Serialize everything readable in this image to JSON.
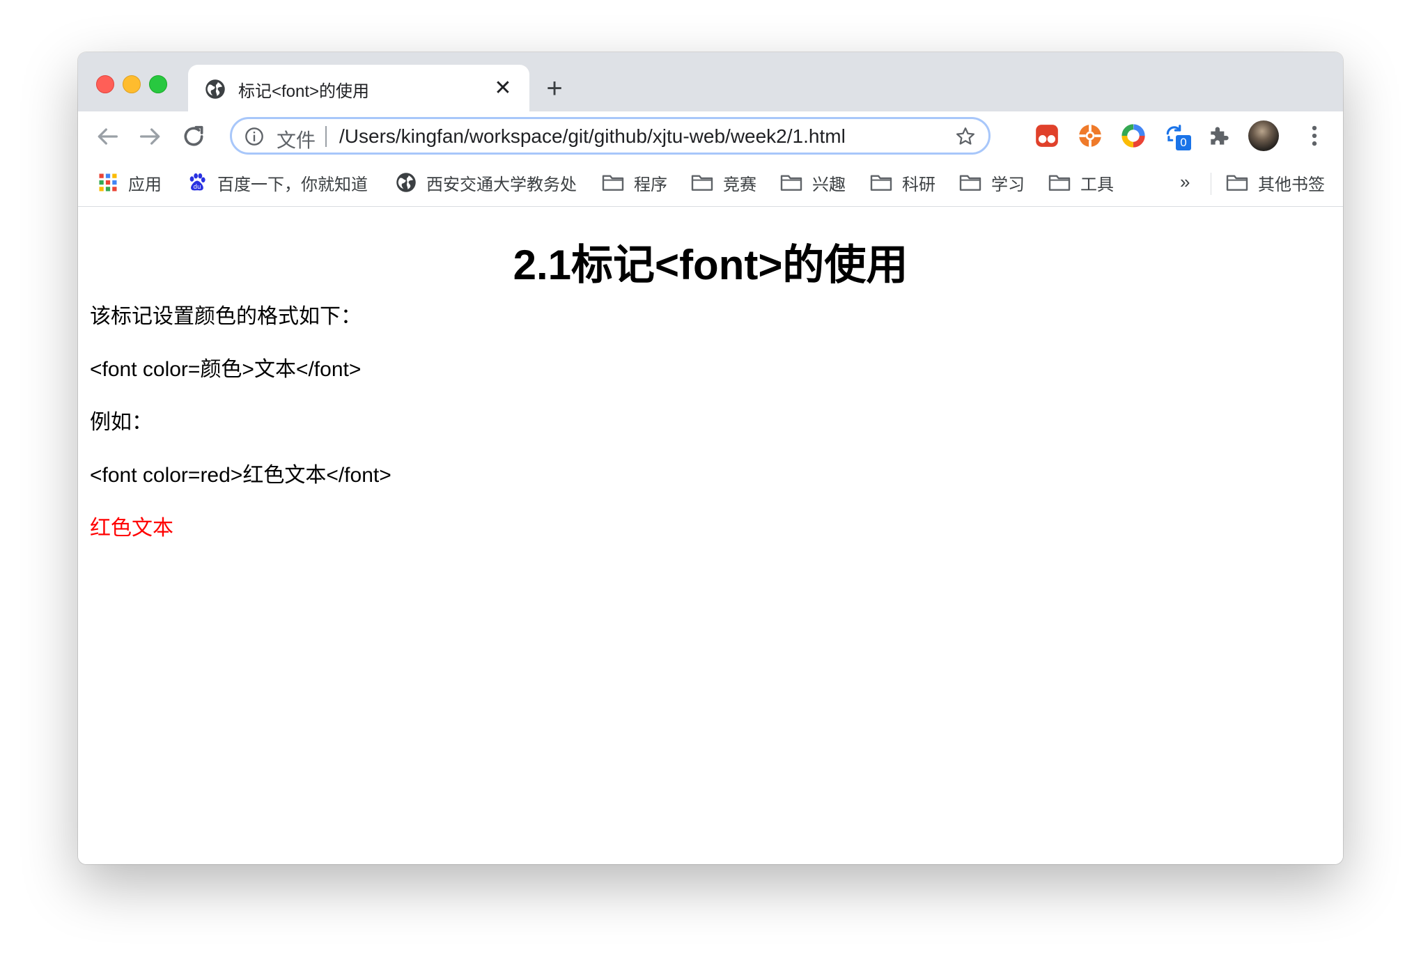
{
  "browser": {
    "tab": {
      "title": "标记<font>的使用",
      "favicon": "globe-icon",
      "close_label": "✕"
    },
    "new_tab_label": "+",
    "omnibox": {
      "scheme_label": "文件",
      "url": "/Users/kingfan/workspace/git/github/xjtu-web/week2/1.html"
    },
    "badge_count": "0",
    "bookmarks": [
      {
        "label": "应用",
        "icon": "apps-grid-icon"
      },
      {
        "label": "百度一下，你就知道",
        "icon": "baidu-paw-icon"
      },
      {
        "label": "西安交通大学教务处",
        "icon": "globe-icon"
      },
      {
        "label": "程序",
        "icon": "folder-icon"
      },
      {
        "label": "竞赛",
        "icon": "folder-icon"
      },
      {
        "label": "兴趣",
        "icon": "folder-icon"
      },
      {
        "label": "科研",
        "icon": "folder-icon"
      },
      {
        "label": "学习",
        "icon": "folder-icon"
      },
      {
        "label": "工具",
        "icon": "folder-icon"
      }
    ],
    "overflow_label": "»",
    "other_bookmarks_label": "其他书签"
  },
  "page": {
    "heading": "2.1标记<font>的使用",
    "paragraphs": [
      "该标记设置颜色的格式如下：",
      "<font color=颜色>文本</font>",
      "例如：",
      "<font color=red>红色文本</font>"
    ],
    "red_text": "红色文本",
    "red_color": "#ff0000"
  },
  "colors": {
    "tabstrip": "#dee1e6",
    "omnibox_focus": "#a8c7fa"
  }
}
